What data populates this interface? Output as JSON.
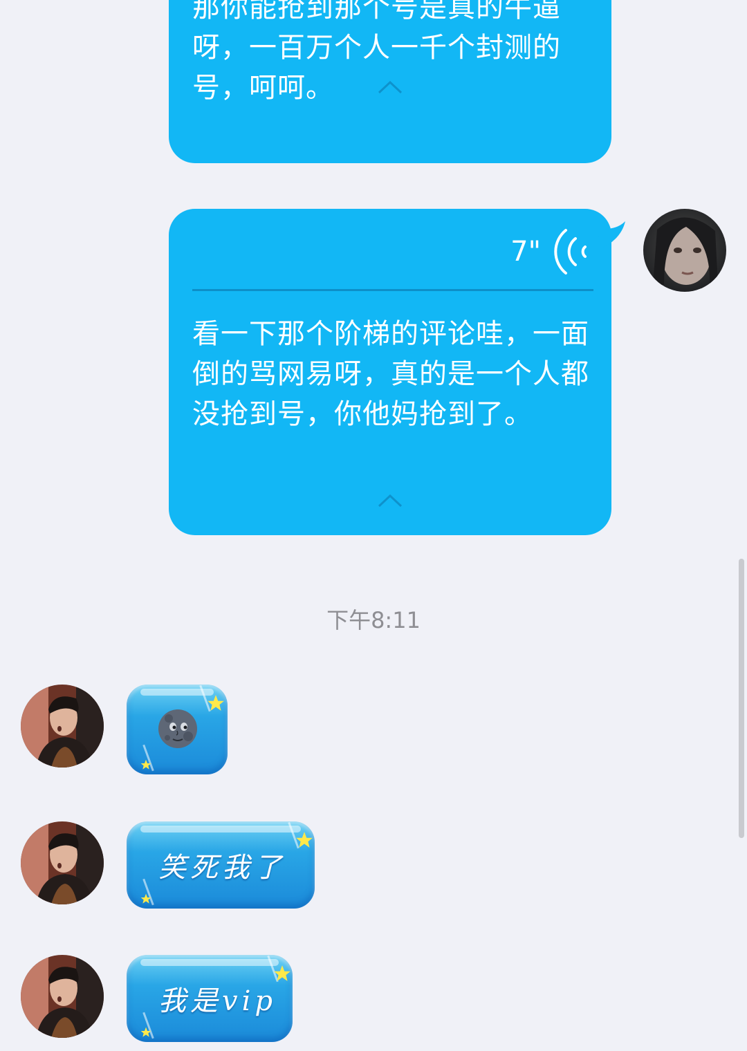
{
  "messages": {
    "outgoing_text_1": "那你能抢到那个号是真的牛逼呀，一百万个人一千个封测的号，呵呵。",
    "outgoing_voice": {
      "duration": "7\"",
      "transcript": "看一下那个阶梯的评论哇，一面倒的骂网易呀，真的是一个人都没抢到号，你他妈抢到了。"
    },
    "timestamp": "下午8:11",
    "incoming": [
      {
        "type": "emoji",
        "emoji": "🌚"
      },
      {
        "type": "text",
        "text": "笑死我了"
      },
      {
        "type": "text",
        "text": "我是vip"
      }
    ]
  },
  "colors": {
    "outgoing_bubble": "#12b7f5",
    "incoming_bubble": "#29a6e6",
    "background": "#f0f1f7"
  },
  "icons": {
    "collapse": "chevron-up-icon",
    "voice": "voice-wave-icon",
    "star": "star-icon"
  }
}
